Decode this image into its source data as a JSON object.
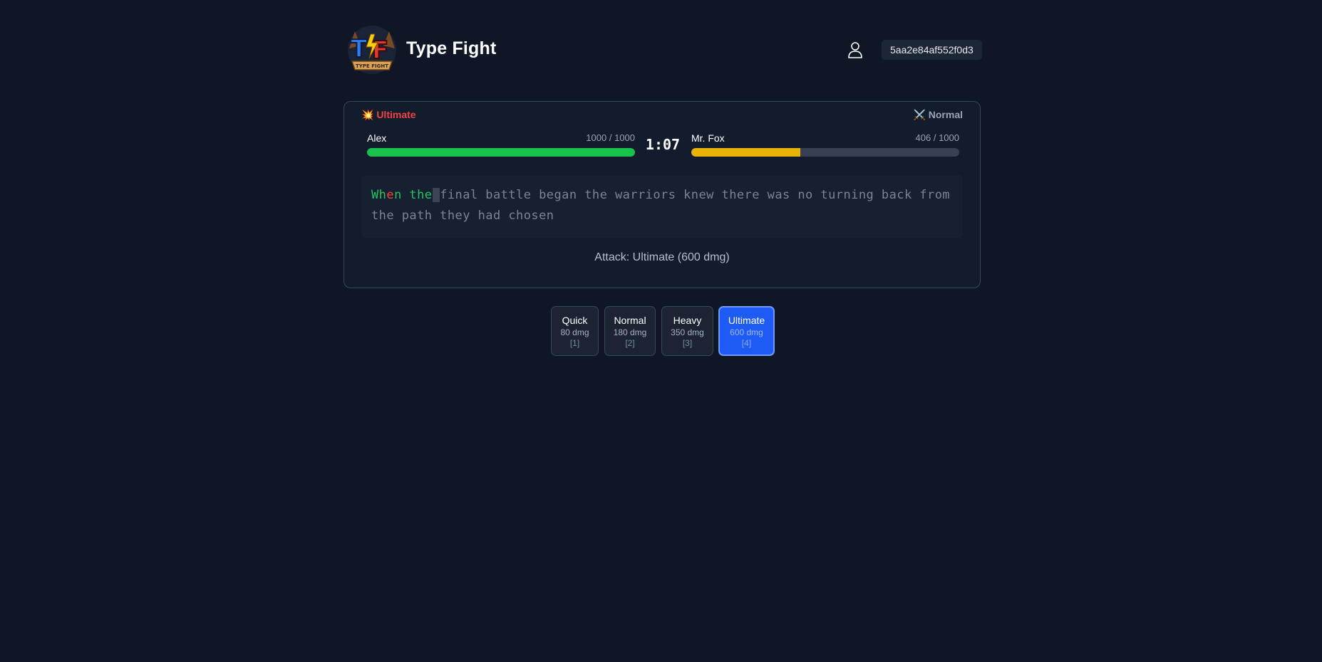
{
  "header": {
    "app_title": "Type Fight",
    "logo_text": "TF",
    "logo_banner": "TYPE FIGHT",
    "session_id": "5aa2e84af552f0d3"
  },
  "battle": {
    "attack_mode": "💥 Ultimate",
    "opponent_mode": "⚔️ Normal",
    "timer": "1:07",
    "player": {
      "name": "Alex",
      "hp_text": "1000 / 1000",
      "hp_fraction": 1.0
    },
    "opponent": {
      "name": "Mr. Fox",
      "hp_text": "406 / 1000",
      "hp_fraction": 0.406
    },
    "typing": {
      "typed_correct_1": "Wh",
      "typed_error": "e",
      "typed_correct_2": "n the",
      "cursor_char": " ",
      "remaining": "final battle began the warriors knew there was no turning back from the path they had chosen"
    },
    "attack_info": "Attack: Ultimate (600 dmg)"
  },
  "attacks": [
    {
      "label": "Quick",
      "damage": "80 dmg",
      "key": "[1]"
    },
    {
      "label": "Normal",
      "damage": "180 dmg",
      "key": "[2]"
    },
    {
      "label": "Heavy",
      "damage": "350 dmg",
      "key": "[3]"
    },
    {
      "label": "Ultimate",
      "damage": "600 dmg",
      "key": "[4]"
    }
  ],
  "colors": {
    "background": "#0f1727",
    "player_hp": "#18c24d",
    "opponent_hp": "#eab308",
    "active_attack": "#1e5bf5",
    "error": "#ef4444",
    "correct": "#22c55e"
  }
}
